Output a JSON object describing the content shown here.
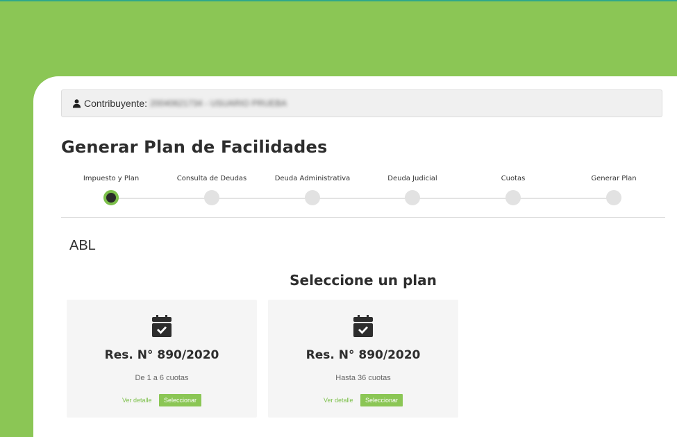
{
  "colors": {
    "background": "#8bc655",
    "accent": "#7dc04b",
    "card": "#ffffff",
    "plan_card": "#f5f5f5"
  },
  "taxpayer": {
    "icon": "user-icon",
    "label": "Contribuyente:",
    "value": "20040621734 - USUARIO PRUEBA"
  },
  "page_title": "Generar Plan de Facilidades",
  "steps": [
    {
      "label": "Impuesto y Plan",
      "active": true
    },
    {
      "label": "Consulta de Deudas",
      "active": false
    },
    {
      "label": "Deuda Administrativa",
      "active": false
    },
    {
      "label": "Deuda Judicial",
      "active": false
    },
    {
      "label": "Cuotas",
      "active": false
    },
    {
      "label": "Generar Plan",
      "active": false
    }
  ],
  "section_name": "ABL",
  "plan_heading": "Seleccione un plan",
  "plans": [
    {
      "icon": "calendar-check-icon",
      "title": "Res. N° 890/2020",
      "description": "De 1 a 6 cuotas",
      "detail_label": "Ver detalle",
      "select_label": "Seleccionar"
    },
    {
      "icon": "calendar-check-icon",
      "title": "Res. N° 890/2020",
      "description": "Hasta 36 cuotas",
      "detail_label": "Ver detalle",
      "select_label": "Seleccionar"
    }
  ]
}
